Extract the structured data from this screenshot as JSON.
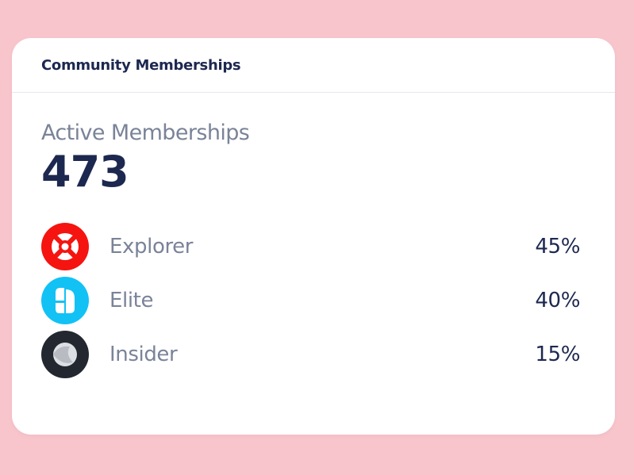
{
  "card": {
    "title": "Community Memberships"
  },
  "metric": {
    "label": "Active Memberships",
    "value": "473"
  },
  "memberships": [
    {
      "name": "Explorer",
      "percent": "45%",
      "logo_color": "#f5140f",
      "icon": "lifebuoy-icon"
    },
    {
      "name": "Elite",
      "percent": "40%",
      "logo_color": "#12c2f5",
      "icon": "split-shape-icon"
    },
    {
      "name": "Insider",
      "percent": "15%",
      "logo_color": "#232830",
      "icon": "overlap-circle-icon"
    }
  ],
  "colors": {
    "background": "#f8c5cc",
    "card": "#ffffff",
    "title_text": "#1d2850",
    "muted_text": "#7a8398"
  }
}
